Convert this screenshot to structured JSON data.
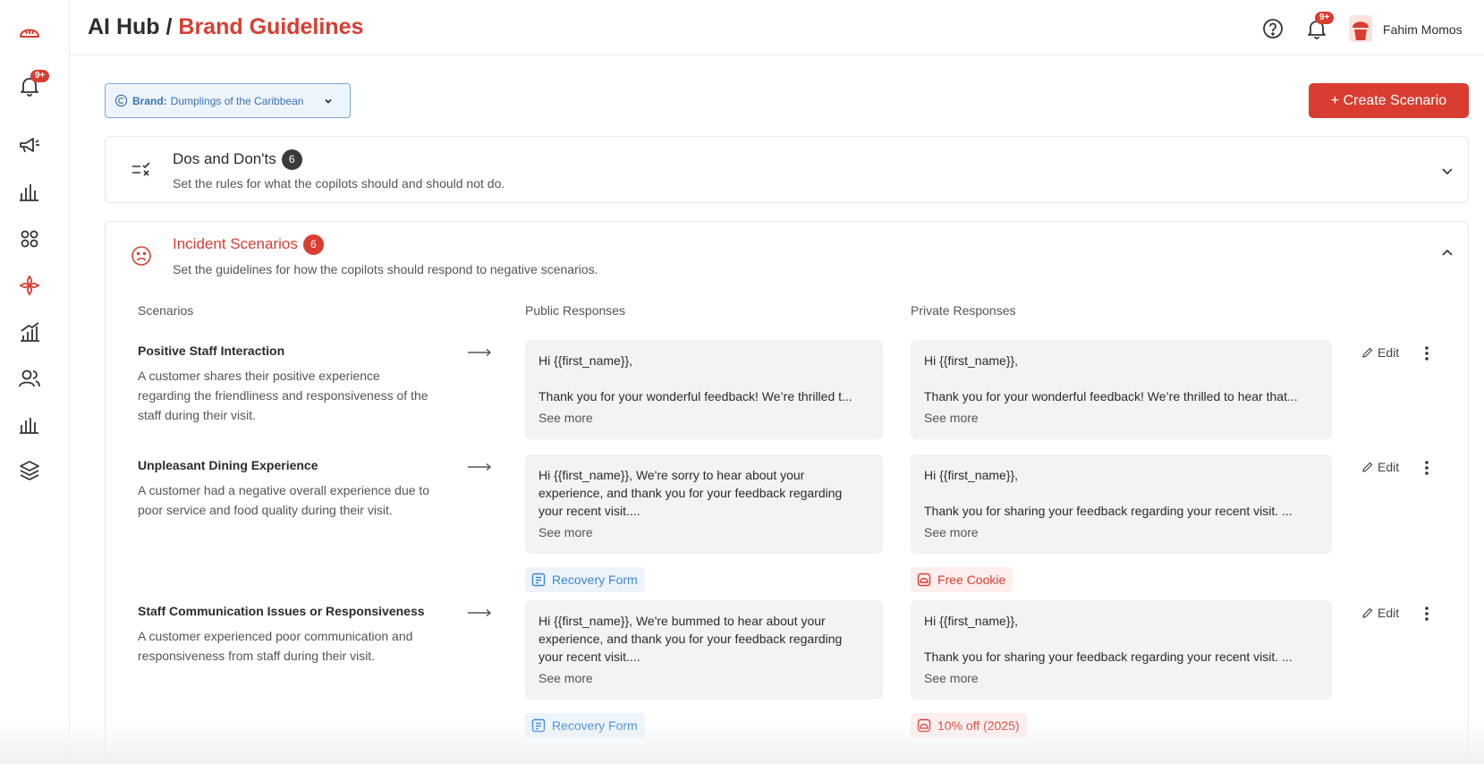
{
  "header": {
    "title_prefix": "AI Hub /",
    "title_accent": "Brand Guidelines",
    "notification_badge": "9+",
    "user_name": "Fahim Momos"
  },
  "sidebar": {
    "notification_badge": "9+",
    "items": [
      "logo-icon",
      "bell-icon",
      "megaphone-icon",
      "bar-chart-icon",
      "apps-grid-icon",
      "ai-flower-icon",
      "growth-chart-icon",
      "users-icon",
      "analytics-icon",
      "layers-icon"
    ]
  },
  "brand_select": {
    "label": "Brand:",
    "value": "Dumplings of the Caribbean"
  },
  "create_button": "+ Create Scenario",
  "dos": {
    "title": "Dos and Don'ts",
    "count": "6",
    "subtitle": "Set the rules for what the copilots should and should not do."
  },
  "incidents": {
    "title": "Incident Scenarios",
    "count": "6",
    "subtitle": "Set the guidelines for how the copilots should respond to negative scenarios.",
    "columns": [
      "Scenarios",
      "Public Responses",
      "Private Responses"
    ],
    "see_more": "See more",
    "edit_label": "Edit",
    "rows": [
      {
        "title": "Positive Staff Interaction",
        "description": "A customer shares their positive experience regarding the friendliness and responsiveness of the staff during their visit.",
        "public_line1": "Hi {{first_name}},",
        "public_line2": "Thank you for your wonderful feedback! We’re thrilled t...",
        "private_line1": "Hi {{first_name}},",
        "private_line2": "Thank you for your wonderful feedback! We’re thrilled to hear that...",
        "public_tag": "",
        "private_tag": ""
      },
      {
        "title": "Unpleasant Dining Experience",
        "description": "A customer had a negative overall experience due to poor service and food quality during their visit.",
        "public_text": "Hi {{first_name}}, We're sorry to hear about your experience, and thank you for your feedback regarding your recent visit....",
        "private_line1": "Hi {{first_name}},",
        "private_line2": "Thank you for sharing your feedback regarding your recent visit. ...",
        "public_tag": "Recovery Form",
        "private_tag": "Free Cookie"
      },
      {
        "title": "Staff Communication Issues or Responsiveness",
        "description": "A customer experienced poor communication and responsiveness from staff during their visit.",
        "public_text": "Hi {{first_name}}, We're bummed to hear about your experience, and thank you for your feedback regarding your recent visit....",
        "private_line1": "Hi {{first_name}},",
        "private_line2": "Thank you for sharing your feedback regarding your recent visit. ...",
        "public_tag": "Recovery Form",
        "private_tag": "10% off (2025)"
      }
    ]
  },
  "colors": {
    "accent": "#d93d31",
    "link_blue": "#3a86d8",
    "badge_dark": "#3a3a3a"
  }
}
